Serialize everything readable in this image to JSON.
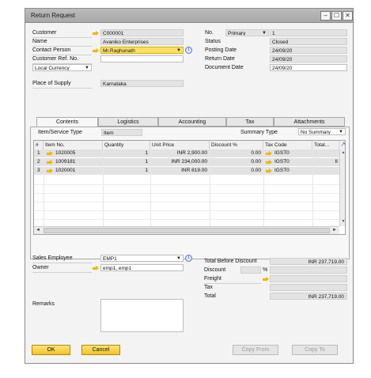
{
  "window": {
    "title": "Return Request"
  },
  "header_left": {
    "customer_label": "Customer",
    "customer_value": "C000001",
    "name_label": "Name",
    "name_value": "Avaniko Enterprises",
    "contact_label": "Contact Person",
    "contact_value": "Mr.Raghunath",
    "ref_label": "Customer Ref. No.",
    "ref_value": "",
    "currency_value": "Local Currency",
    "place_label": "Place of Supply",
    "place_value": "Karnataka"
  },
  "header_right": {
    "no_label": "No.",
    "no_series": "Primary",
    "no_value": "1",
    "status_label": "Status",
    "status_value": "Closed",
    "posting_label": "Posting Date",
    "posting_value": "24/09/20",
    "return_label": "Return Date",
    "return_value": "24/09/20",
    "document_label": "Document Date",
    "document_value": "24/09/20"
  },
  "tabs": [
    {
      "label": "Contents"
    },
    {
      "label": "Logistics"
    },
    {
      "label": "Accounting"
    },
    {
      "label": "Tax"
    },
    {
      "label": "Attachments"
    }
  ],
  "contents": {
    "item_type_label": "Item/Service Type",
    "item_type_value": "Item",
    "summary_label": "Summary Type",
    "summary_value": "No Summary"
  },
  "table": {
    "columns": [
      "#",
      "Item No.",
      "Quantity",
      "Unit Price",
      "Discount %",
      "Tax Code",
      "Total..."
    ],
    "rows": [
      {
        "num": "1",
        "item": "1020005",
        "qty": "1",
        "price": "INR 2,900.00",
        "disc": "0.00",
        "tax": "IGST0",
        "total": ""
      },
      {
        "num": "2",
        "item": "1009181",
        "qty": "1",
        "price": "INR 234,000.00",
        "disc": "0.00",
        "tax": "IGST0",
        "total": "II"
      },
      {
        "num": "3",
        "item": "1020001",
        "qty": "1",
        "price": "INR 819.00",
        "disc": "0.00",
        "tax": "IGST0",
        "total": ""
      }
    ]
  },
  "footer_left": {
    "sales_label": "Sales Employee",
    "sales_value": "EMP1",
    "owner_label": "Owner",
    "owner_value": "emp1, emp1",
    "remarks_label": "Remarks"
  },
  "footer_right": {
    "tbd_label": "Total Before Discount",
    "tbd_value": "INR 237,719.00",
    "discount_label": "Discount",
    "discount_pct_symbol": "%",
    "freight_label": "Freight",
    "tax_label": "Tax",
    "total_label": "Total",
    "total_value": "INR 237,719.00"
  },
  "buttons": {
    "ok": "OK",
    "cancel": "Cancel",
    "copy_from": "Copy From",
    "copy_to": "Copy To"
  },
  "colors": {
    "accent_yellow": "#f3c227",
    "field_gray": "#e3e3e3",
    "row_gray": "#e2e2e2"
  }
}
